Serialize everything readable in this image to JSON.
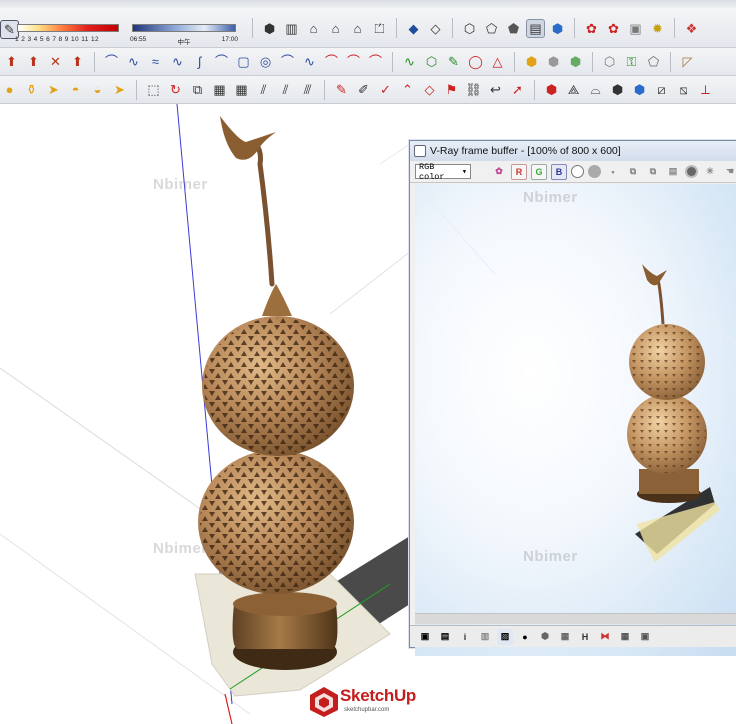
{
  "toolbar": {
    "shadow_months": "1 2 3 4 5 6 7 8 9 10 11 12",
    "time_start": "06:55",
    "time_mid": "中午",
    "time_end": "17:00"
  },
  "vfb": {
    "title": "V-Ray frame buffer - [100% of 800 x 600]",
    "channel_select": "RGB color",
    "btn_r": "R",
    "btn_g": "G",
    "btn_b": "B",
    "bottom_i": "i",
    "bottom_h": "H"
  },
  "watermarks": [
    "Nbimer",
    "Nbimer",
    "Nbimer",
    "Nbimer"
  ],
  "logo": {
    "text": "SketchUp",
    "sub": "sketchupbar.com"
  },
  "colors": {
    "accent": "#c41d1d",
    "vase": "#b98a55",
    "axis_blue": "#3b3bd9",
    "axis_green": "#1fa01f",
    "axis_red": "#d62020"
  }
}
